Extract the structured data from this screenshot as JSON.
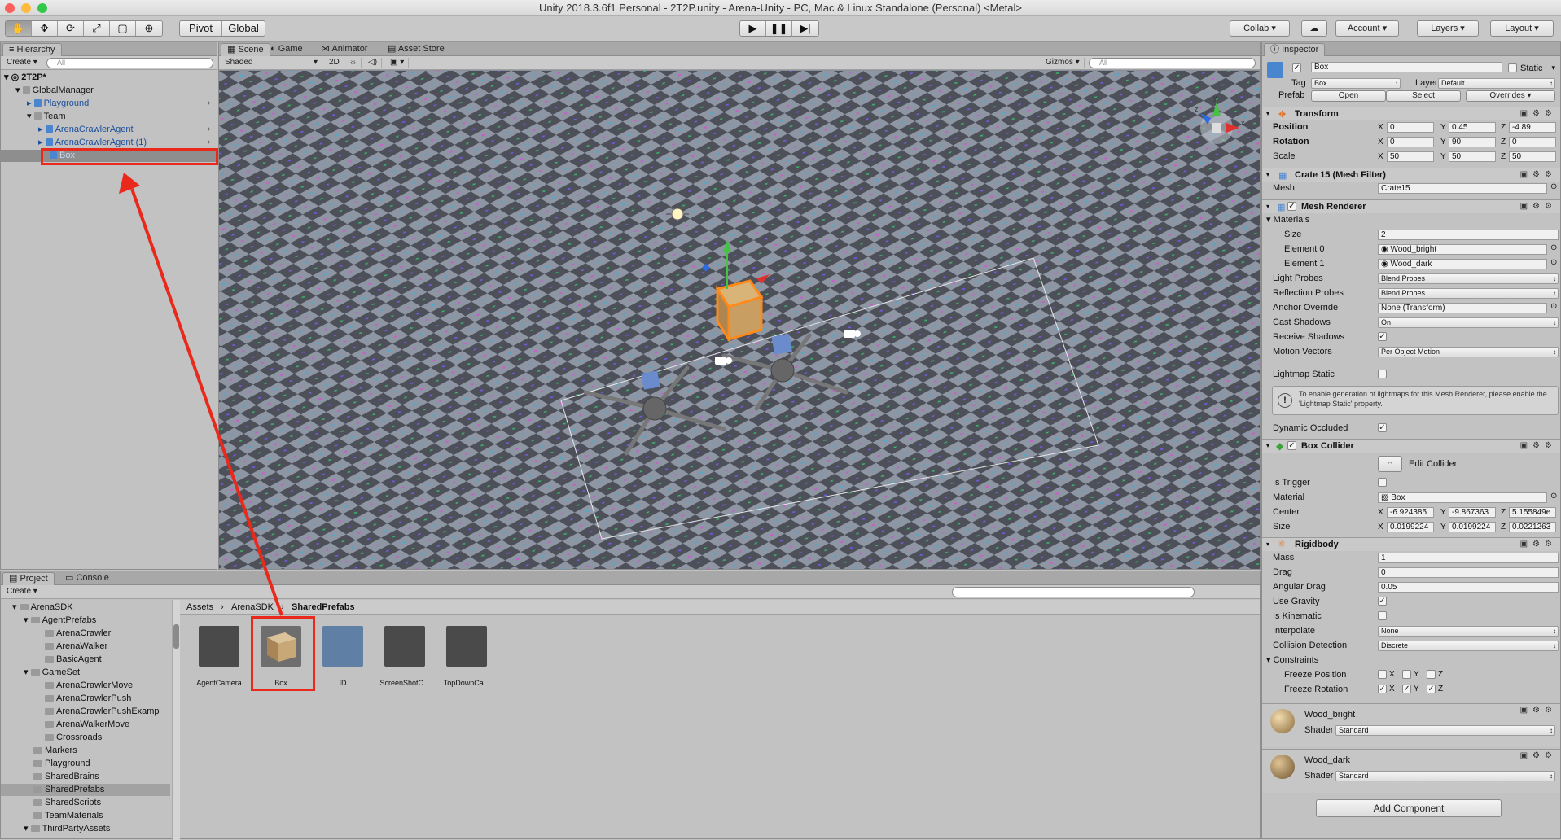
{
  "window": {
    "title": "Unity 2018.3.6f1 Personal - 2T2P.unity - Arena-Unity - PC, Mac & Linux Standalone (Personal) <Metal>"
  },
  "toolbar": {
    "tools": [
      "hand-tool",
      "move-tool",
      "rotate-tool",
      "scale-tool",
      "rect-tool",
      "transform-tool"
    ],
    "pivot": "Pivot",
    "global": "Global",
    "collab": "Collab",
    "account": "Account",
    "layers": "Layers",
    "layout": "Layout"
  },
  "hierarchy": {
    "tab": "Hierarchy",
    "create": "Create",
    "search_placeholder": "All",
    "scene": "2T2P*",
    "items": [
      "GlobalManager",
      "Playground",
      "Team",
      "ArenaCrawlerAgent",
      "ArenaCrawlerAgent (1)",
      "Box"
    ]
  },
  "scene": {
    "tabs": [
      "Scene",
      "Game",
      "Animator",
      "Asset Store"
    ],
    "shading": "Shaded",
    "mode_2d": "2D",
    "gizmos": "Gizmos",
    "search_placeholder": "All",
    "gizmo_axes": [
      "x",
      "y",
      "z"
    ]
  },
  "project": {
    "tabs": [
      "Project",
      "Console"
    ],
    "create": "Create",
    "tree": [
      "ArenaSDK",
      "AgentPrefabs",
      "ArenaCrawler",
      "ArenaWalker",
      "BasicAgent",
      "GameSet",
      "ArenaCrawlerMove",
      "ArenaCrawlerPush",
      "ArenaCrawlerPushExamp",
      "ArenaWalkerMove",
      "Crossroads",
      "Markers",
      "Playground",
      "SharedBrains",
      "SharedPrefabs",
      "SharedScripts",
      "TeamMaterials",
      "ThirdPartyAssets"
    ],
    "breadcrumb": [
      "Assets",
      "ArenaSDK",
      "SharedPrefabs"
    ],
    "assets": [
      "AgentCamera",
      "Box",
      "ID",
      "ScreenShotC...",
      "TopDownCa..."
    ]
  },
  "inspector": {
    "tab": "Inspector",
    "object_name": "Box",
    "static": "Static",
    "tag_label": "Tag",
    "tag": "Box",
    "layer_label": "Layer",
    "layer": "Default",
    "prefab_label": "Prefab",
    "open": "Open",
    "select": "Select",
    "overrides": "Overrides",
    "transform": {
      "title": "Transform",
      "position_label": "Position",
      "position": [
        "0",
        "0.45",
        "-4.89"
      ],
      "rotation_label": "Rotation",
      "rotation": [
        "0",
        "90",
        "0"
      ],
      "scale_label": "Scale",
      "scale": [
        "50",
        "50",
        "50"
      ]
    },
    "mesh_filter": {
      "title": "Crate 15 (Mesh Filter)",
      "mesh_label": "Mesh",
      "mesh": "Crate15"
    },
    "mesh_renderer": {
      "title": "Mesh Renderer",
      "materials_label": "Materials",
      "size_label": "Size",
      "size": "2",
      "element0_label": "Element 0",
      "element0": "Wood_bright",
      "element1_label": "Element 1",
      "element1": "Wood_dark",
      "light_probes_label": "Light Probes",
      "light_probes": "Blend Probes",
      "reflection_probes_label": "Reflection Probes",
      "reflection_probes": "Blend Probes",
      "anchor_override_label": "Anchor Override",
      "anchor_override": "None (Transform)",
      "cast_shadows_label": "Cast Shadows",
      "cast_shadows": "On",
      "receive_shadows_label": "Receive Shadows",
      "motion_vectors_label": "Motion Vectors",
      "motion_vectors": "Per Object Motion",
      "lightmap_static_label": "Lightmap Static",
      "info": "To enable generation of lightmaps for this Mesh Renderer, please enable the 'Lightmap Static' property.",
      "dynamic_occluded_label": "Dynamic Occluded"
    },
    "box_collider": {
      "title": "Box Collider",
      "edit_collider": "Edit Collider",
      "is_trigger_label": "Is Trigger",
      "material_label": "Material",
      "material": "Box",
      "center_label": "Center",
      "center": [
        "-6.924385",
        "-9.867363",
        "5.155849e"
      ],
      "size_label": "Size",
      "size": [
        "0.0199224",
        "0.0199224",
        "0.0221263"
      ]
    },
    "rigidbody": {
      "title": "Rigidbody",
      "mass_label": "Mass",
      "mass": "1",
      "drag_label": "Drag",
      "drag": "0",
      "angular_drag_label": "Angular Drag",
      "angular_drag": "0.05",
      "use_gravity_label": "Use Gravity",
      "is_kinematic_label": "Is Kinematic",
      "interpolate_label": "Interpolate",
      "interpolate": "None",
      "collision_detection_label": "Collision Detection",
      "collision_detection": "Discrete",
      "constraints_label": "Constraints",
      "freeze_position_label": "Freeze Position",
      "freeze_rotation_label": "Freeze Rotation",
      "axis_x": "X",
      "axis_y": "Y",
      "axis_z": "Z"
    },
    "materials": [
      {
        "name": "Wood_bright",
        "shader_label": "Shader",
        "shader": "Standard"
      },
      {
        "name": "Wood_dark",
        "shader_label": "Shader",
        "shader": "Standard"
      }
    ],
    "add_component": "Add Component"
  },
  "colors": {
    "accent": "#3d7be0",
    "highlight": "#e8291b",
    "panel": "#c2c2c2"
  }
}
